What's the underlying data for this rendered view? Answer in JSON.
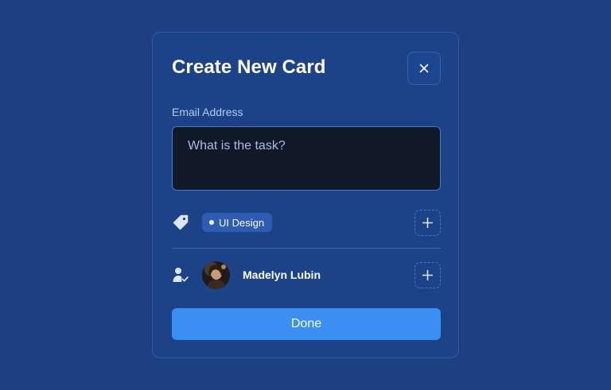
{
  "modal": {
    "title": "Create New Card",
    "close_icon": "close-icon"
  },
  "task_field": {
    "label": "Email Address",
    "value": "",
    "placeholder": "What is the task?"
  },
  "tags": {
    "icon": "tag-icon",
    "items": [
      {
        "label": "UI Design"
      }
    ],
    "add_icon": "plus-icon"
  },
  "members": {
    "icon": "user-check-icon",
    "items": [
      {
        "name": "Madelyn Lubin"
      }
    ],
    "add_icon": "plus-icon"
  },
  "actions": {
    "done_label": "Done"
  },
  "colors": {
    "background": "#1b3f80",
    "modal": "#1c4288",
    "input_bg": "#111827",
    "chip": "#2e5bb4",
    "primary_button": "#3b8ef2"
  }
}
